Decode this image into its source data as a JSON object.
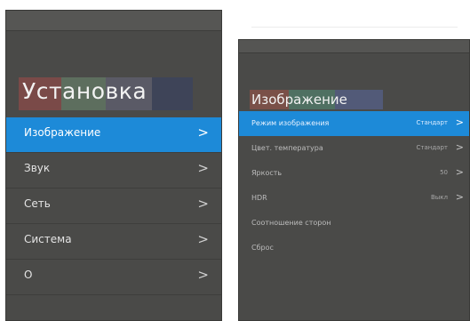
{
  "left_panel": {
    "title": "Установка",
    "items": [
      {
        "label": "Изображение",
        "chevron": ">",
        "selected": true
      },
      {
        "label": "Звук",
        "chevron": ">",
        "selected": false
      },
      {
        "label": "Сеть",
        "chevron": ">",
        "selected": false
      },
      {
        "label": "Система",
        "chevron": ">",
        "selected": false
      },
      {
        "label": "О",
        "chevron": ">",
        "selected": false
      }
    ]
  },
  "right_panel": {
    "title": "Изображение",
    "items": [
      {
        "label": "Режим изображения",
        "value": "Стандарт",
        "chevron": ">",
        "selected": true
      },
      {
        "label": "Цвет. температура",
        "value": "Стандарт",
        "chevron": ">",
        "selected": false
      },
      {
        "label": "Яркость",
        "value": "50",
        "chevron": ">",
        "selected": false
      },
      {
        "label": "HDR",
        "value": "Выкл",
        "chevron": ">",
        "selected": false
      },
      {
        "label": "Соотношение сторон",
        "value": "",
        "chevron": "",
        "selected": false
      },
      {
        "label": "Сброс",
        "value": "",
        "chevron": "",
        "selected": false
      }
    ]
  },
  "colors": {
    "accent": "#1d8ad8",
    "panel_bg": "#4a4a48"
  }
}
